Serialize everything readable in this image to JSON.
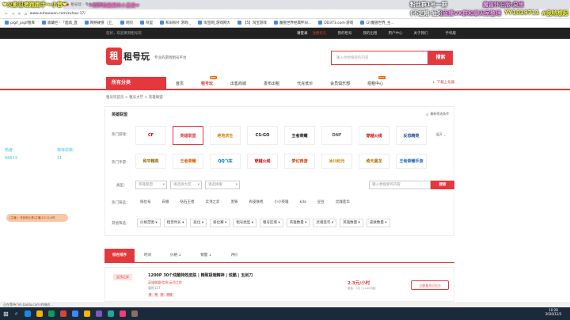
{
  "tabs": [
    {
      "label": "大丽 · 多玩版 · ..."
    },
    {
      "label": "租号玩 - 专业的游戏 ..."
    }
  ],
  "address": {
    "url": "www.zuhaowan.com/zuhao-17/"
  },
  "bookmarks": [
    "pigif_pigif图库",
    "收藏栏 · 「面具_直",
    "网络硬盘（卫_",
    "网页",
    "阿里",
    "和旧照片 游戏·_",
    "淘宝网_游戏网大",
    "【5】淘宝游戏",
    "魔兽世界经典怀旧...",
    "DD373.com·游戏",
    "(2)魔兽世界_主..."
  ],
  "overlays": {
    "top_left": "❤火影忍者跑跑手～小晋❤",
    "top_left2": "❤后羿我最爱的小孟姜❤",
    "top_right_a": "粉丝群1号一群",
    "top_right_b": "魔兽怀旧版:莫里",
    "row2_a": "(不定期 抽奖",
    "row2_b": "(直播VX群和聊天室整理",
    "row2_c": "YY1019711",
    "row2_d": "#我特想起",
    "left_label1": "热度：",
    "left_label2": "等待票数：",
    "left_val1": "68613",
    "left_val2": "11",
    "left_chat": "[主播]：来到和小晋(主播)10:11小时"
  },
  "topstrip": {
    "welcome": "您好，欢迎来到租号玩",
    "login": "请登录",
    "register": "注册有礼",
    "links": [
      "我的租号",
      "我的出租",
      "用户中心",
      "关于我们",
      "手机版"
    ]
  },
  "header": {
    "brand": "租号玩",
    "slogan": "专业的游戏租号平台",
    "search_placeholder": "输入你想搜索的内容",
    "search_btn": "搜索"
  },
  "nav": {
    "category": "所有分类",
    "items": [
      "首页",
      "租号玩",
      "出售商城",
      "发布出租",
      "代充低价",
      "会员俱乐部",
      "招租中心"
    ],
    "hot_badge": "HOT",
    "download": "下载上号器"
  },
  "breadcrumb": "租号玩首页 > 租号大厅 > 英雄联盟",
  "filter": {
    "selected_game": "英雄联盟",
    "more_label": "最新筛选条件",
    "hot_games_label": "热门游戏：",
    "hot_games": [
      "CF",
      "英雄联盟",
      "绝地求生",
      "CS:GO",
      "王者荣耀",
      "DNF",
      "穿越火线",
      "反恐精英"
    ],
    "hot_mobile_label": "热门手游：",
    "hot_mobile": [
      "和平精英",
      "王者荣耀",
      "QQ飞车",
      "穿越火线",
      "梦幻西游",
      "冰川纪元",
      "倚天屠龙",
      "王者荣耀手游"
    ],
    "expand_label": "展开",
    "type_label": "类型：",
    "dropdowns": [
      "英雄联盟",
      "请选择大区",
      "请选择服"
    ],
    "search_placeholder": "输入想搜索的内容",
    "search_btn": "搜索",
    "hot_label": "热门筛选：",
    "chips": [
      "排位号",
      "白银",
      "钻石王者",
      "云顶之弈",
      "黑铁",
      "有皮肤者",
      "小小英雄",
      "kda",
      "豆豆",
      "灵魂莲华"
    ],
    "range_label": "其他筛选：",
    "options": [
      "价格范围",
      "租赁时长",
      "段位",
      "排位赛",
      "租号类型",
      "租号区域",
      "英雄数量",
      "灵魂莲华",
      "英雄数量",
      "皮肤数量"
    ]
  },
  "sort": {
    "tabs": [
      "综合排序",
      "时间",
      "价格 ↓",
      "销量 ↓",
      "评价"
    ]
  },
  "listing": {
    "tag": "云顶之弈",
    "title": "1200P 30个炫酷特效皮肤 | 精致极端精神 | 炫酷 | 玉剑刀",
    "sub": "英雄联盟/信息/云顶之弈",
    "sub2": "冒险117",
    "price": "2.3元/小时",
    "price_note": "租金：5元 | 1240出租",
    "rent_btn": "立即租号(可日)",
    "badges": [
      "首",
      "荐",
      "新",
      "超值"
    ]
  },
  "statusbar": "正在等待 hm.baidu.com 的响应...",
  "taskbar": {
    "time": "10:28",
    "date": "2020/12/2"
  }
}
